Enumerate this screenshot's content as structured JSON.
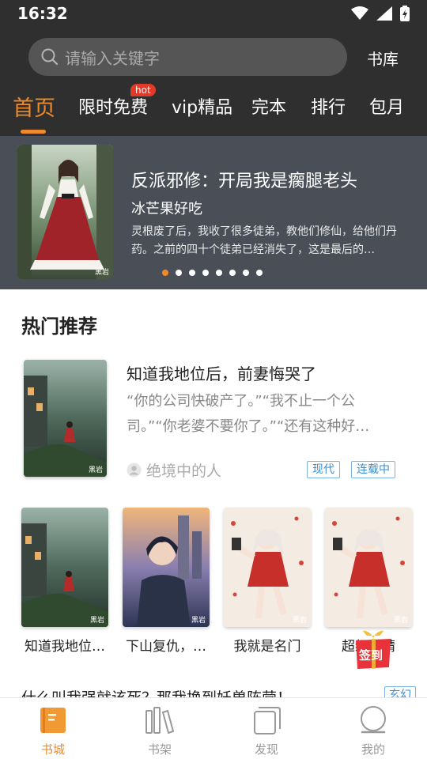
{
  "status": {
    "time": "16:32"
  },
  "header": {
    "search_placeholder": "请输入关键字",
    "library_link": "书库"
  },
  "tabs": [
    {
      "label": "首页",
      "active": true
    },
    {
      "label": "限时免费",
      "badge": "hot"
    },
    {
      "label": "vip精品"
    },
    {
      "label": "完本"
    },
    {
      "label": "排行"
    },
    {
      "label": "包月"
    }
  ],
  "banner": {
    "title": "反派邪修：开局我是瘸腿老头",
    "author": "冰芒果好吃",
    "description": "灵根废了后，我收了很多徒弟，教他们修仙，给他们丹药。之前的四十个徒弟已经消失了，这是最后的…",
    "cover_watermark": "黑岩",
    "dot_count": 8,
    "active_dot": 0
  },
  "hot": {
    "section_title": "热门推荐",
    "featured": {
      "title": "知道我地位后，前妻悔哭了",
      "description": "“你的公司快破产了。”“我不止一个公司。”“你老婆不要你了。”“还有这种好…",
      "author": "绝境中的人",
      "tags": [
        "现代",
        "连载中"
      ],
      "cover_watermark": "黑岩"
    },
    "grid": [
      {
        "title": "知道我地位…",
        "cover_watermark": "黑岩"
      },
      {
        "title": "下山复仇，…",
        "cover_watermark": "黑岩"
      },
      {
        "title": "我就是名门",
        "cover_watermark": "黑岩"
      },
      {
        "title": "超级…靖",
        "cover_watermark": "黑岩"
      }
    ],
    "signin_label": "签到",
    "next_item_title": "什么叫我强就该死？那我换到妖兽阵营！",
    "next_item_tag": "玄幻"
  },
  "bottom_nav": [
    {
      "label": "书城",
      "active": true
    },
    {
      "label": "书架"
    },
    {
      "label": "发现"
    },
    {
      "label": "我的"
    }
  ],
  "colors": {
    "accent": "#ef8a2a",
    "header_bg": "#2f2f2f",
    "banner_bg": "#4a4f57",
    "badge_red": "#e23a2a",
    "tag_blue": "#3a8fd6"
  }
}
